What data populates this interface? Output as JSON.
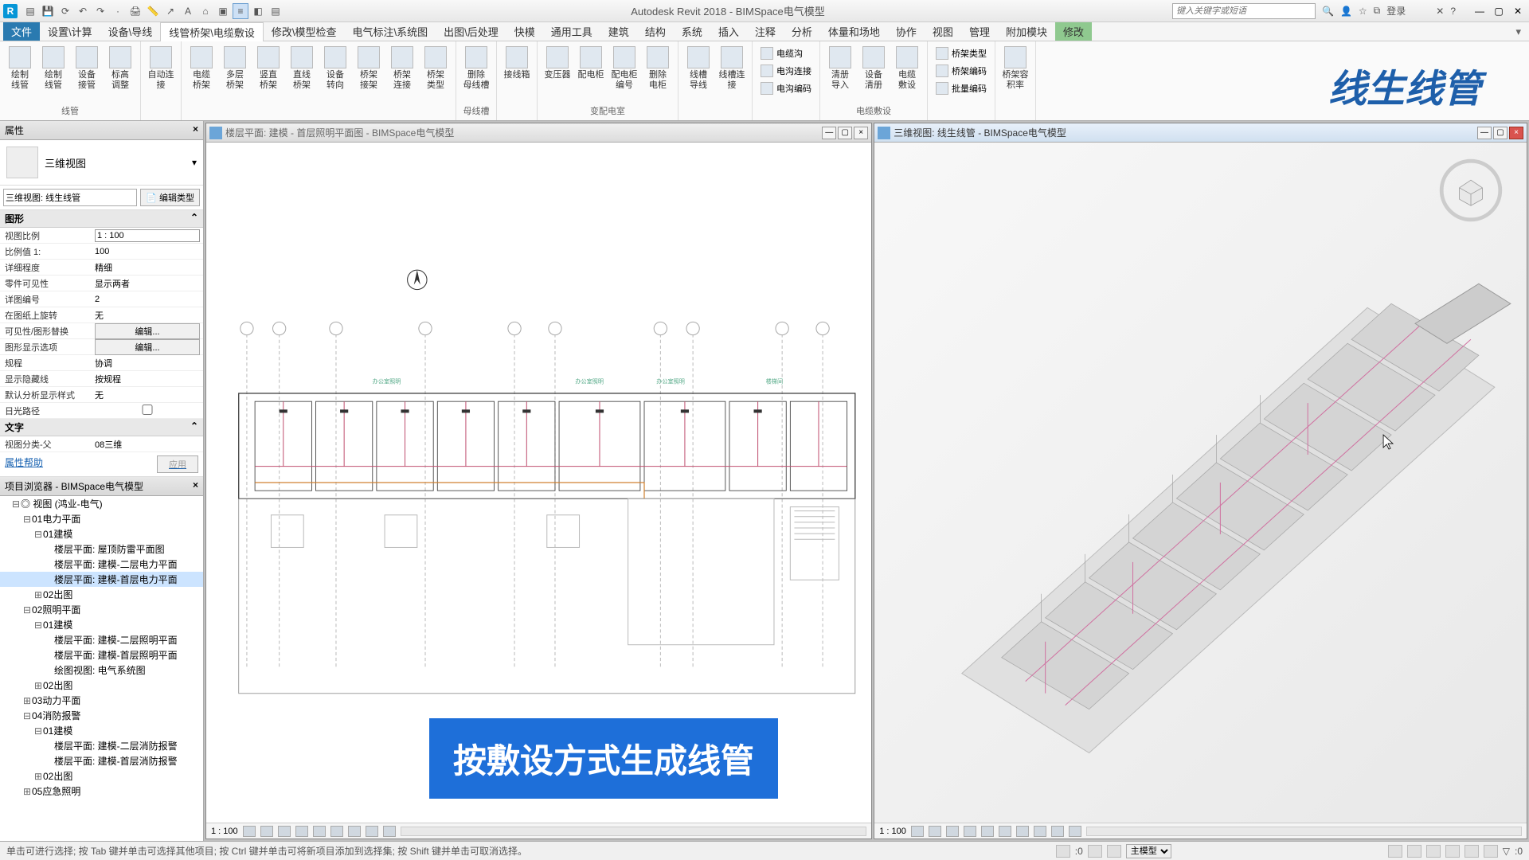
{
  "title": {
    "app": "Autodesk Revit 2018",
    "sep": " - ",
    "doc": "BIMSpace电气模型"
  },
  "search_placeholder": "键入关键字或短语",
  "login_label": "登录",
  "menu": {
    "file": "文件",
    "items": [
      "设置\\计算",
      "设备\\导线",
      "线管桥架\\电缆敷设",
      "修改\\模型检查",
      "电气标注\\系统图",
      "出图\\后处理",
      "快模",
      "通用工具",
      "建筑",
      "结构",
      "系统",
      "插入",
      "注释",
      "分析",
      "体量和场地",
      "协作",
      "视图",
      "管理",
      "附加模块",
      "修改"
    ],
    "active_index": 2
  },
  "brand": "线生线管",
  "ribbon": {
    "groups": [
      {
        "buttons": [
          {
            "l": "绘制\n线管"
          },
          {
            "l": "绘制\n线管"
          },
          {
            "l": "设备\n接管"
          },
          {
            "l": "标高\n调整"
          }
        ],
        "label": "线管"
      },
      {
        "buttons": [
          {
            "l": "自动连接"
          }
        ],
        "label": ""
      },
      {
        "buttons": [
          {
            "l": "电缆\n桥架"
          },
          {
            "l": "多层\n桥架"
          },
          {
            "l": "竖直\n桥架"
          },
          {
            "l": "直线\n桥架"
          },
          {
            "l": "设备\n转向"
          },
          {
            "l": "桥架\n接架"
          },
          {
            "l": "桥架\n连接"
          },
          {
            "l": "桥架\n类型"
          }
        ],
        "label": ""
      },
      {
        "buttons": [
          {
            "l": "删除\n母线槽"
          }
        ],
        "label": "母线槽"
      },
      {
        "buttons": [
          {
            "l": "接线箱"
          }
        ],
        "label": ""
      },
      {
        "buttons": [
          {
            "l": "变压器"
          },
          {
            "l": "配电柜"
          },
          {
            "l": "配电柜\n编号"
          },
          {
            "l": "删除\n电柜"
          }
        ],
        "label": "变配电室"
      },
      {
        "buttons": [
          {
            "l": "线槽\n导线"
          },
          {
            "l": "线槽连接"
          }
        ],
        "label": ""
      },
      {
        "small": [
          {
            "l": "电缆沟"
          },
          {
            "l": "电沟连接"
          },
          {
            "l": "电沟编码"
          }
        ],
        "label": ""
      },
      {
        "buttons": [
          {
            "l": "清册\n导入"
          },
          {
            "l": "设备\n清册"
          },
          {
            "l": "电缆\n敷设"
          }
        ],
        "label": "电缆敷设"
      },
      {
        "small": [
          {
            "l": "桥架类型"
          },
          {
            "l": "桥架编码"
          },
          {
            "l": "批量编码"
          }
        ],
        "label": ""
      },
      {
        "buttons": [
          {
            "l": "桥架容积率"
          }
        ],
        "label": ""
      }
    ]
  },
  "props": {
    "panel_title": "属性",
    "type_name": "三维视图",
    "view_combo": "三维视图: 线生线管",
    "edit_type": "编辑类型",
    "section1": "图形",
    "rows1": [
      {
        "k": "视图比例",
        "v": "1 : 100",
        "input": true
      },
      {
        "k": "比例值 1:",
        "v": "100"
      },
      {
        "k": "详细程度",
        "v": "精细"
      },
      {
        "k": "零件可见性",
        "v": "显示两者"
      },
      {
        "k": "详图编号",
        "v": "2"
      },
      {
        "k": "在图纸上旋转",
        "v": "无"
      },
      {
        "k": "可见性/图形替换",
        "v": "编辑...",
        "btn": true
      },
      {
        "k": "图形显示选项",
        "v": "编辑...",
        "btn": true
      },
      {
        "k": "规程",
        "v": "协调"
      },
      {
        "k": "显示隐藏线",
        "v": "按规程"
      },
      {
        "k": "默认分析显示样式",
        "v": "无"
      },
      {
        "k": "日光路径",
        "v": "",
        "check": true
      }
    ],
    "section2": "文字",
    "rows2": [
      {
        "k": "视图分类-父",
        "v": "08三维"
      }
    ],
    "help": "属性帮助",
    "apply": "应用"
  },
  "browser": {
    "title": "项目浏览器 - BIMSpace电气模型",
    "tree": [
      {
        "t": "-",
        "d": 1,
        "l": "视图 (鸿业-电气)",
        "icon": true
      },
      {
        "t": "-",
        "d": 2,
        "l": "01电力平面"
      },
      {
        "t": "-",
        "d": 3,
        "l": "01建模"
      },
      {
        "t": "",
        "d": 4,
        "l": "楼层平面: 屋顶防雷平面图"
      },
      {
        "t": "",
        "d": 4,
        "l": "楼层平面: 建模-二层电力平面"
      },
      {
        "t": "",
        "d": 4,
        "l": "楼层平面: 建模-首层电力平面",
        "sel": true
      },
      {
        "t": "+",
        "d": 3,
        "l": "02出图"
      },
      {
        "t": "-",
        "d": 2,
        "l": "02照明平面"
      },
      {
        "t": "-",
        "d": 3,
        "l": "01建模"
      },
      {
        "t": "",
        "d": 4,
        "l": "楼层平面: 建模-二层照明平面"
      },
      {
        "t": "",
        "d": 4,
        "l": "楼层平面: 建模-首层照明平面"
      },
      {
        "t": "",
        "d": 4,
        "l": "绘图视图: 电气系统图"
      },
      {
        "t": "+",
        "d": 3,
        "l": "02出图"
      },
      {
        "t": "+",
        "d": 2,
        "l": "03动力平面"
      },
      {
        "t": "-",
        "d": 2,
        "l": "04消防报警"
      },
      {
        "t": "-",
        "d": 3,
        "l": "01建模"
      },
      {
        "t": "",
        "d": 4,
        "l": "楼层平面: 建模-二层消防报警"
      },
      {
        "t": "",
        "d": 4,
        "l": "楼层平面: 建模-首层消防报警"
      },
      {
        "t": "+",
        "d": 3,
        "l": "02出图"
      },
      {
        "t": "+",
        "d": 2,
        "l": "05应急照明"
      }
    ]
  },
  "views": {
    "left": {
      "title": "楼层平面: 建模 - 首层照明平面图 - BIMSpace电气模型",
      "scale": "1 : 100"
    },
    "right": {
      "title": "三维视图: 线生线管 - BIMSpace电气模型",
      "scale": "1 : 100"
    }
  },
  "overlay": "按敷设方式生成线管",
  "status": {
    "msg": "单击可进行选择; 按 Tab 键并单击可选择其他项目; 按 Ctrl 键并单击可将新项目添加到选择集; 按 Shift 键并单击可取消选择。",
    "zero": ":0",
    "model": "主模型",
    "filter": ":0"
  }
}
